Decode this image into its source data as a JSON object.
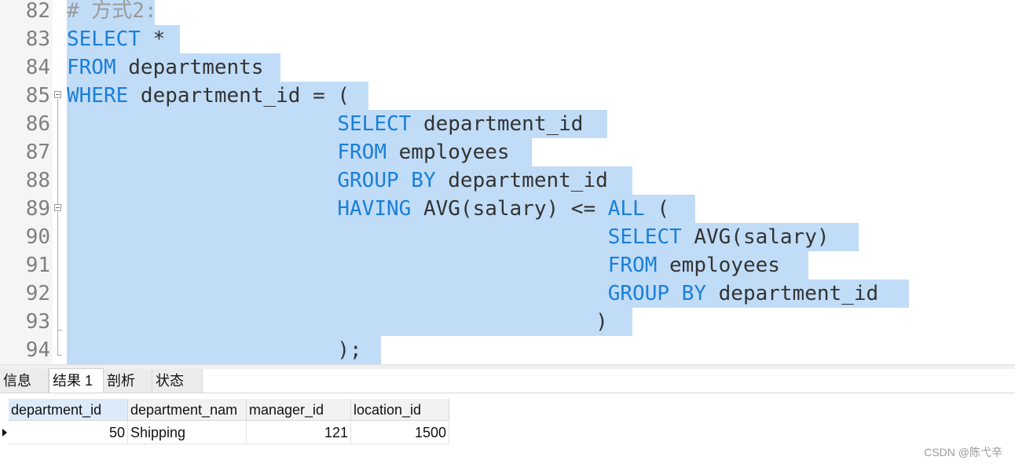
{
  "editor": {
    "lines": [
      {
        "no": "82",
        "tokens": [
          {
            "t": "# 方式2:",
            "c": "cm"
          }
        ]
      },
      {
        "no": "83",
        "tokens": [
          {
            "t": "SELECT",
            "c": "kw"
          },
          {
            "t": " *",
            "c": ""
          }
        ]
      },
      {
        "no": "84",
        "tokens": [
          {
            "t": "FROM",
            "c": "kw"
          },
          {
            "t": " departments",
            "c": ""
          }
        ]
      },
      {
        "no": "85",
        "tokens": [
          {
            "t": "WHERE",
            "c": "kw"
          },
          {
            "t": " department_id = (",
            "c": ""
          }
        ]
      },
      {
        "no": "86",
        "tokens": [
          {
            "t": "                      ",
            "c": ""
          },
          {
            "t": "SELECT",
            "c": "kw"
          },
          {
            "t": " department_id",
            "c": ""
          }
        ]
      },
      {
        "no": "87",
        "tokens": [
          {
            "t": "                      ",
            "c": ""
          },
          {
            "t": "FROM",
            "c": "kw"
          },
          {
            "t": " employees",
            "c": ""
          }
        ]
      },
      {
        "no": "88",
        "tokens": [
          {
            "t": "                      ",
            "c": ""
          },
          {
            "t": "GROUP BY",
            "c": "kw"
          },
          {
            "t": " department_id",
            "c": ""
          }
        ]
      },
      {
        "no": "89",
        "tokens": [
          {
            "t": "                      ",
            "c": ""
          },
          {
            "t": "HAVING",
            "c": "kw"
          },
          {
            "t": " AVG(salary) <= ",
            "c": ""
          },
          {
            "t": "ALL",
            "c": "kw"
          },
          {
            "t": " (",
            "c": ""
          }
        ]
      },
      {
        "no": "90",
        "tokens": [
          {
            "t": "                                            ",
            "c": ""
          },
          {
            "t": "SELECT",
            "c": "kw"
          },
          {
            "t": " AVG(salary)",
            "c": ""
          }
        ]
      },
      {
        "no": "91",
        "tokens": [
          {
            "t": "                                            ",
            "c": ""
          },
          {
            "t": "FROM",
            "c": "kw"
          },
          {
            "t": " employees",
            "c": ""
          }
        ]
      },
      {
        "no": "92",
        "tokens": [
          {
            "t": "                                            ",
            "c": ""
          },
          {
            "t": "GROUP BY",
            "c": "kw"
          },
          {
            "t": " department_id",
            "c": ""
          }
        ]
      },
      {
        "no": "93",
        "tokens": [
          {
            "t": "                                           )",
            "c": ""
          }
        ]
      },
      {
        "no": "94",
        "tokens": [
          {
            "t": "                      );",
            "c": ""
          }
        ]
      }
    ]
  },
  "tabs": [
    {
      "label": "信息",
      "active": false
    },
    {
      "label": "结果 1",
      "active": true
    },
    {
      "label": "剖析",
      "active": false
    },
    {
      "label": "状态",
      "active": false
    }
  ],
  "result": {
    "columns": [
      "department_id",
      "department_nam",
      "manager_id",
      "location_id"
    ],
    "rows": [
      [
        "50",
        "Shipping",
        "121",
        "1500"
      ]
    ]
  },
  "watermark": "CSDN @陈弋辛",
  "colors": {
    "keyword": "#1a7fd9",
    "selection": "#c0dcf7",
    "comment": "#9a9a9a"
  }
}
